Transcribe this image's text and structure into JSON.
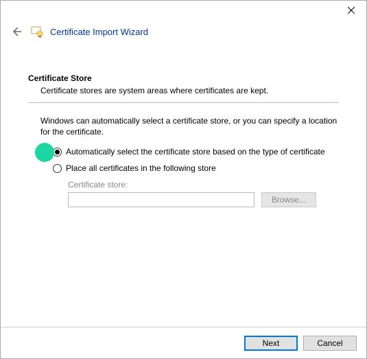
{
  "window": {
    "title": "Certificate Import Wizard"
  },
  "page": {
    "heading": "Certificate Store",
    "subheading": "Certificate stores are system areas where certificates are kept.",
    "instruction": "Windows can automatically select a certificate store, or you can specify a location for the certificate.",
    "options": {
      "auto": "Automatically select the certificate store based on the type of certificate",
      "manual": "Place all certificates in the following store",
      "selected": "auto"
    },
    "store_field": {
      "label": "Certificate store:",
      "value": "",
      "browse_label": "Browse..."
    }
  },
  "footer": {
    "next": "Next",
    "cancel": "Cancel"
  }
}
